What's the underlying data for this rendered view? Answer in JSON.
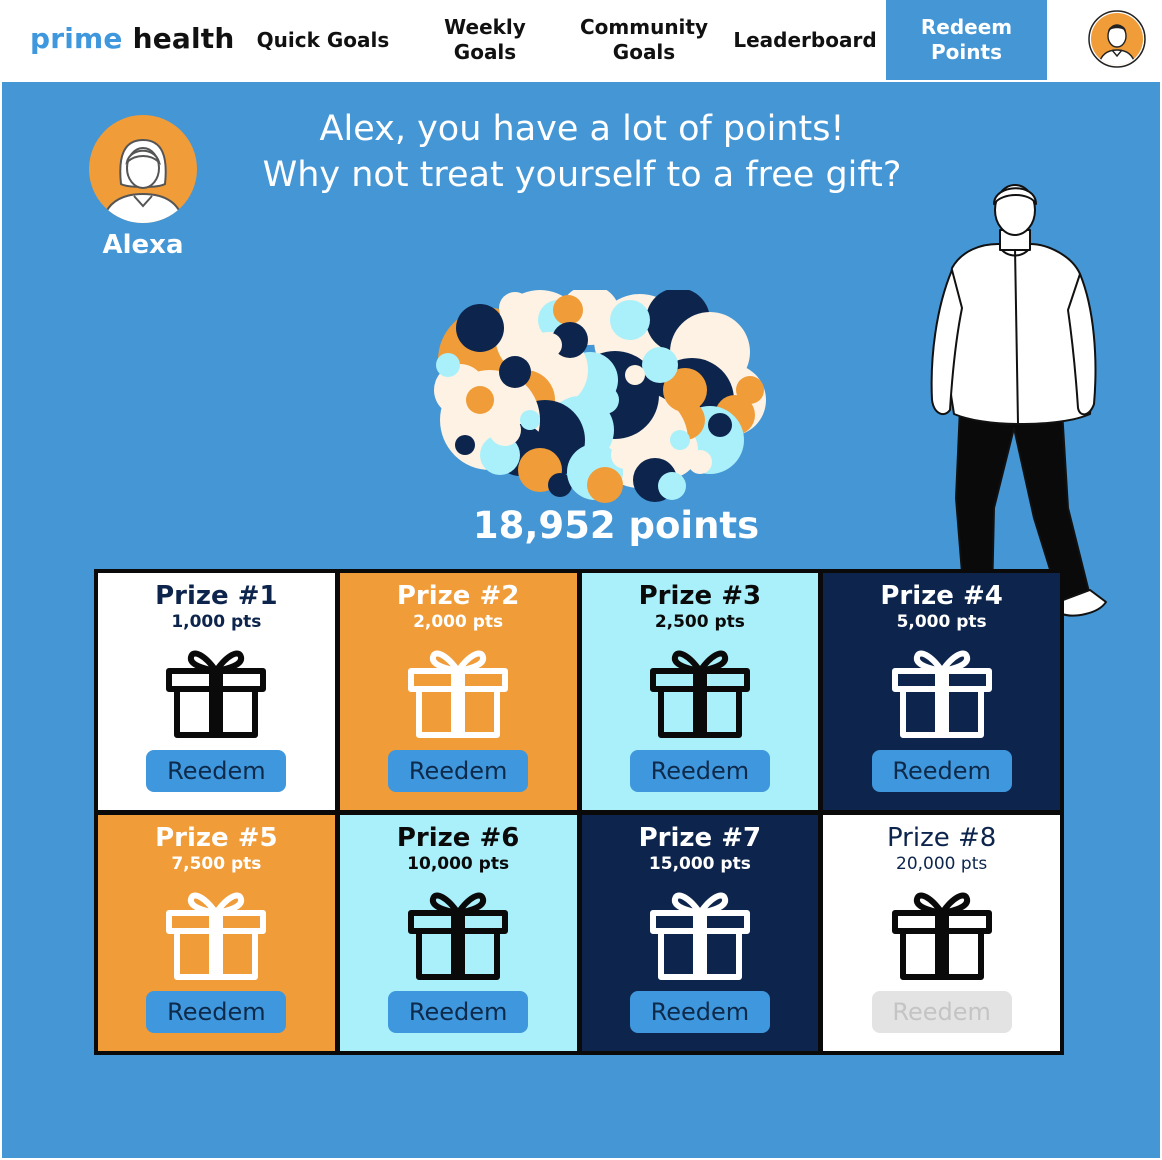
{
  "brand": {
    "prime": "prime",
    "health": "health"
  },
  "nav": {
    "items": [
      {
        "label": "Quick Goals"
      },
      {
        "label": "Weekly Goals"
      },
      {
        "label": "Community Goals"
      },
      {
        "label": "Leaderboard"
      },
      {
        "label": "Redeem Points"
      }
    ],
    "active_index": 4,
    "avatar_icon": "user-avatar-icon"
  },
  "assistant": {
    "name": "Alexa",
    "icon": "assistant-avatar-icon"
  },
  "message": {
    "line1": "Alex, you have a lot of points!",
    "line2": "Why not treat yourself to a free gift?"
  },
  "points": {
    "total_label": "18,952 points"
  },
  "prizes": [
    {
      "title": "Prize #1",
      "points": "1,000 pts",
      "button": "Reedem",
      "enabled": true
    },
    {
      "title": "Prize #2",
      "points": "2,000 pts",
      "button": "Reedem",
      "enabled": true
    },
    {
      "title": "Prize #3",
      "points": "2,500 pts",
      "button": "Reedem",
      "enabled": true
    },
    {
      "title": "Prize #4",
      "points": "5,000 pts",
      "button": "Reedem",
      "enabled": true
    },
    {
      "title": "Prize #5",
      "points": "7,500 pts",
      "button": "Reedem",
      "enabled": true
    },
    {
      "title": "Prize #6",
      "points": "10,000 pts",
      "button": "Reedem",
      "enabled": true
    },
    {
      "title": "Prize #7",
      "points": "15,000 pts",
      "button": "Reedem",
      "enabled": true
    },
    {
      "title": "Prize #8",
      "points": "20,000 pts",
      "button": "Reedem",
      "enabled": false
    }
  ],
  "colors": {
    "accent_blue": "#4496d5",
    "orange": "#f09c38",
    "light_cyan": "#aaf0fa",
    "navy": "#0d254d",
    "cream": "#fdf2e3"
  }
}
